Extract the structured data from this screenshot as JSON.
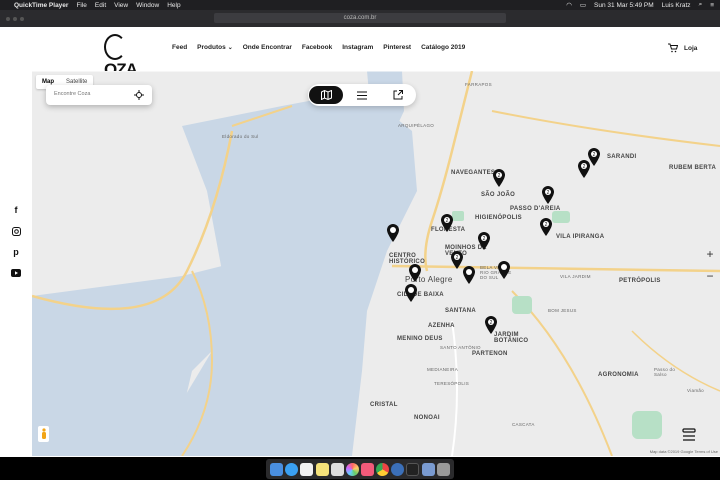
{
  "menubar": {
    "app_name": "QuickTime Player",
    "menus": [
      "File",
      "Edit",
      "View",
      "Window",
      "Help"
    ],
    "datetime": "Sun 31 Mar  5:49 PM",
    "user": "Luis Kratz"
  },
  "browser": {
    "url": "coza.com.br"
  },
  "header": {
    "logo_text": "OZA",
    "nav": [
      "Feed",
      "Produtos",
      "Onde Encontrar",
      "Facebook",
      "Instagram",
      "Pinterest",
      "Catálogo 2019"
    ],
    "cart_label": "Loja"
  },
  "social_icons": [
    "facebook-icon",
    "instagram-icon",
    "pinterest-icon",
    "youtube-icon"
  ],
  "map": {
    "tabs": [
      "Map",
      "Satellite"
    ],
    "search_placeholder": "Encontre Coza",
    "zoom_in": "+",
    "zoom_out": "−",
    "attribution": "Map data ©2019 Google   Terms of Use",
    "places": [
      "Eldorado do Sul",
      "FARRAPOS",
      "ARQUIPÉLAGO",
      "NAVEGANTES",
      "SÃO JOÃO",
      "SARANDI",
      "RUBEM BERTA",
      "PASSO D'AREIA",
      "HIGIENÓPOLIS",
      "FLORESTA",
      "CENTRO HISTÓRICO",
      "MOINHOS DE VENTO",
      "VILA IPIRANGA",
      "Porto Alegre",
      "BELA VISTA, RIO GRANDE DO SUL",
      "VILA JARDIM",
      "PETRÓPOLIS",
      "CIDADE BAIXA",
      "SANTANA",
      "AZENHA",
      "BOM JESUS",
      "MENINO DEUS",
      "JARDIM BOTÂNICO",
      "SANTO ANTÔNIO",
      "PARTENON",
      "MEDIANEIRA",
      "Passo do Salso",
      "AGRONOMIA",
      "Viamão",
      "TERESÓPOLIS",
      "CRISTAL",
      "NONOAI",
      "CASCATA"
    ],
    "pin_counts": [
      "2",
      "2",
      "2",
      "2",
      "2",
      "2",
      "",
      "2",
      "2",
      "",
      "",
      "",
      "2",
      "",
      ""
    ]
  }
}
